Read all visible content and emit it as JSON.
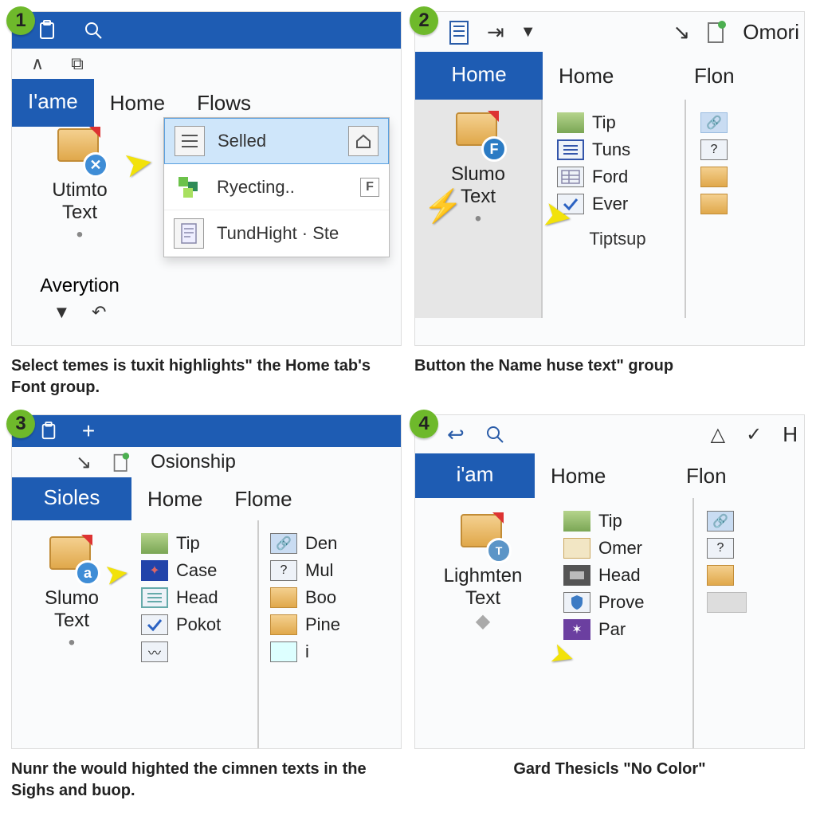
{
  "panels": [
    {
      "num": "1",
      "caption": "Select temes is tuxit highlights\" the  Home tab's Font group.",
      "tabs": {
        "active": "I'ame",
        "second": "Home",
        "third": "Flows"
      },
      "leftBtn": {
        "line1": "Utimto",
        "line2": "Text",
        "aver": "Averytion"
      },
      "flyout": {
        "item1": "Selled",
        "item2": "Ryecting..",
        "item3": "TundHight · Ste"
      }
    },
    {
      "num": "2",
      "caption": "Button the Name huse text\" group",
      "tabs": {
        "active": "Home",
        "second": "Home",
        "third": "Flon",
        "rightTitle": "Omori"
      },
      "leftBtn": {
        "line1": "Slumo",
        "line2": "Text"
      },
      "items": [
        "Tip",
        "Tuns",
        "Ford",
        "Ever"
      ],
      "groupLabel": "Tiptsup"
    },
    {
      "num": "3",
      "caption": "Nunr the would highted the cimnen texts in the Sighs and buop.",
      "tabs": {
        "active": "Sioles",
        "second": "Home",
        "third": "Flome",
        "rightTitle": "Osionship"
      },
      "leftBtn": {
        "line1": "Slumo",
        "line2": "Text"
      },
      "colA": [
        "Tip",
        "Case",
        "Head",
        "Pokot"
      ],
      "colB": [
        "Den",
        "Mul",
        "Boo",
        "Pine",
        "i"
      ]
    },
    {
      "num": "4",
      "caption": "Gard Thesicls \"No Color\"",
      "tabs": {
        "active": "i'am",
        "second": "Home",
        "third": "Flon",
        "rightTitle": "H"
      },
      "leftBtn": {
        "line1": "Lighmten",
        "line2": "Text"
      },
      "colA": [
        "Tip",
        "Omer",
        "Head",
        "Prove",
        "Par"
      ]
    }
  ]
}
